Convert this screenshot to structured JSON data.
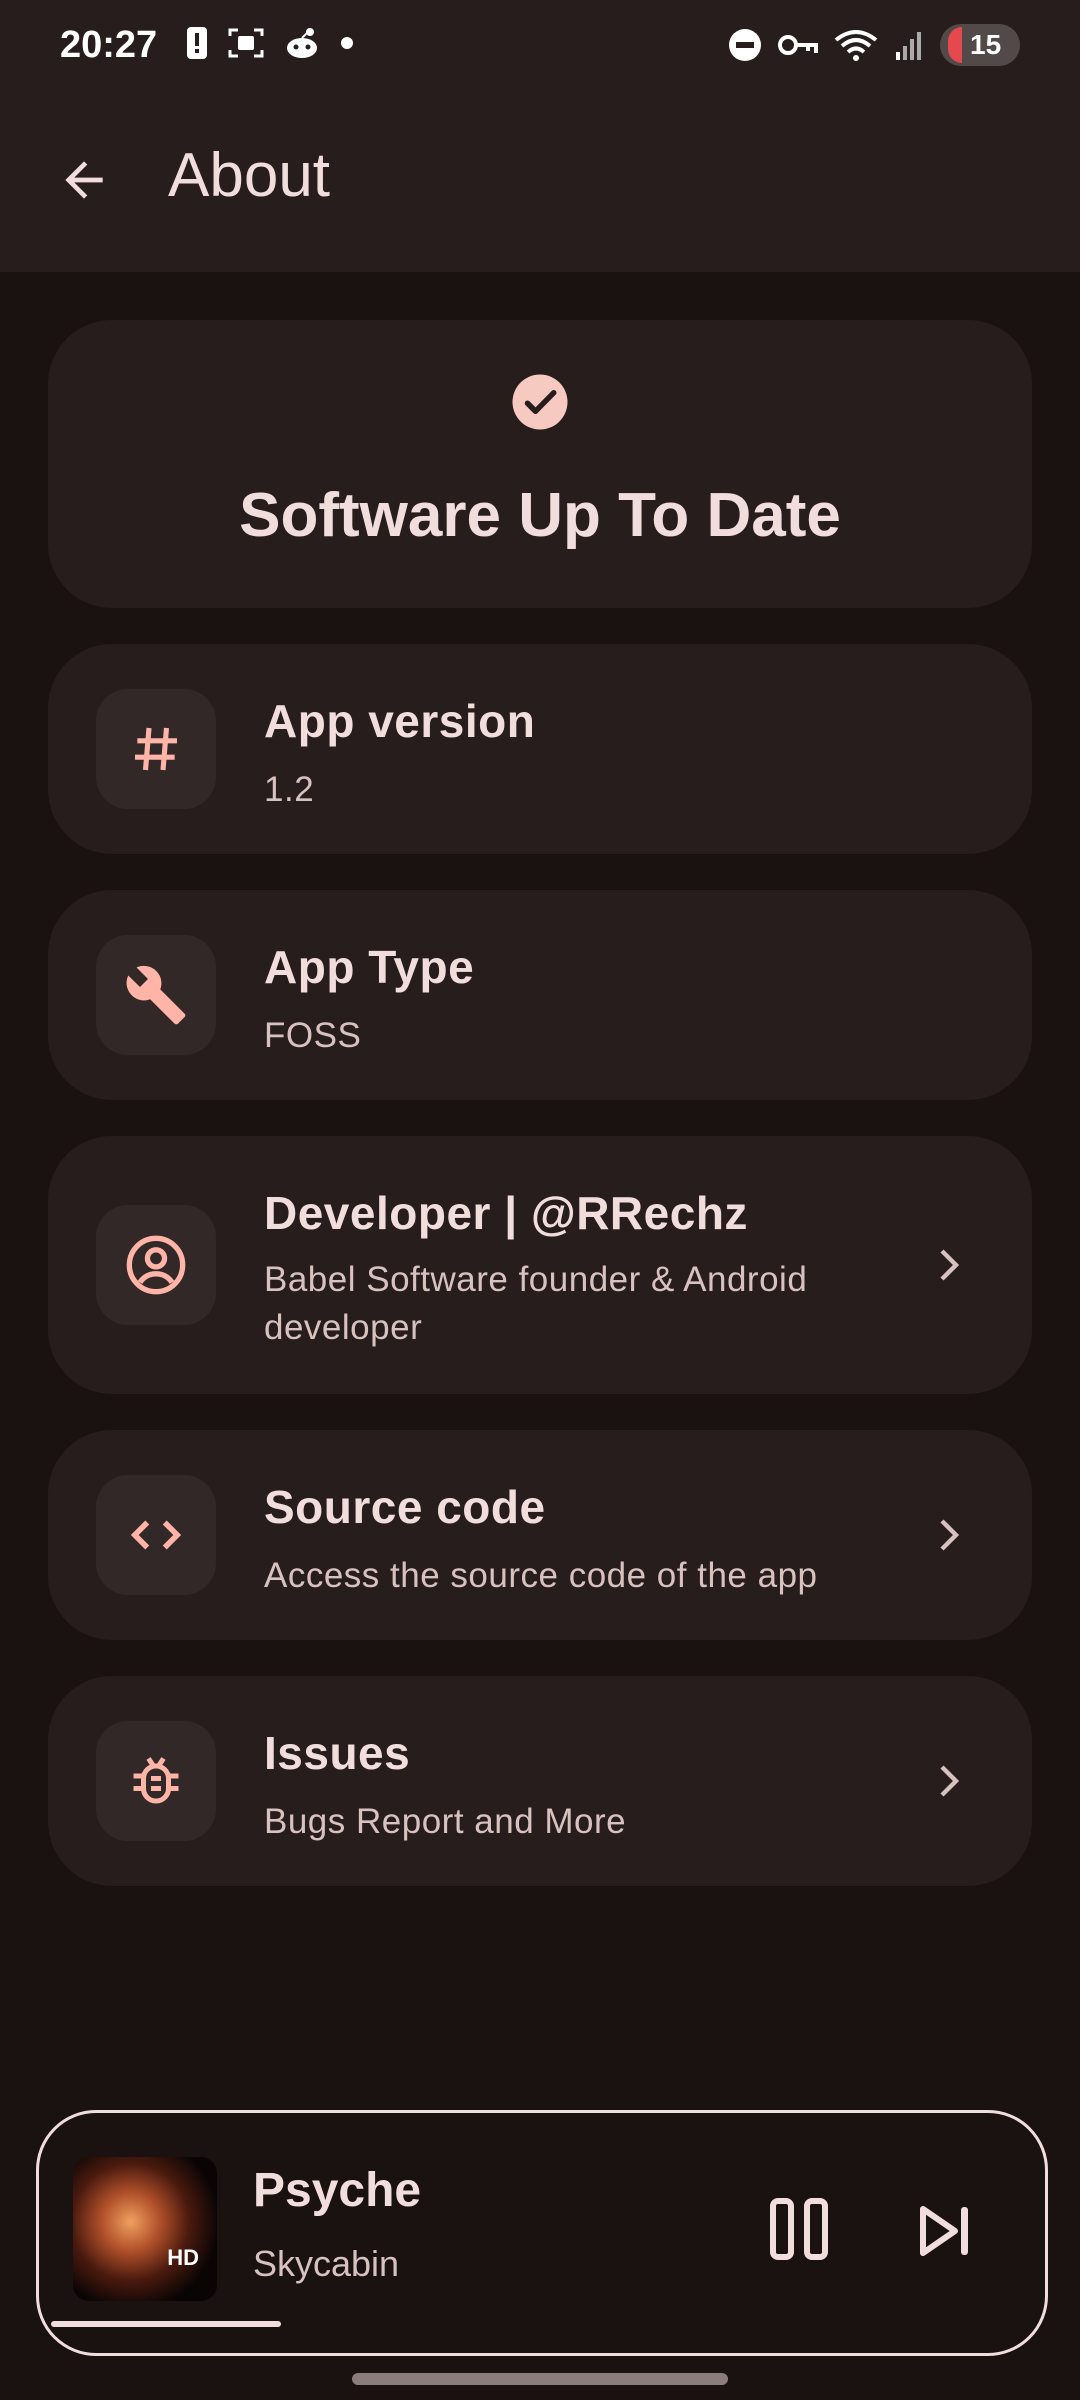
{
  "status_bar": {
    "time": "20:27",
    "battery_level": "15",
    "icons_left": [
      "alert-icon",
      "screenshot-icon",
      "reddit-icon",
      "dot-icon"
    ],
    "icons_right": [
      "dnd-icon",
      "vpn-key-icon",
      "wifi-icon",
      "signal-icon"
    ]
  },
  "top_bar": {
    "title": "About"
  },
  "status_card": {
    "title": "Software Up To Date",
    "icon": "check-circle-icon"
  },
  "rows": [
    {
      "title": "App version",
      "subtitle": "1.2",
      "icon": "hash-icon",
      "chevron": false
    },
    {
      "title": "App Type",
      "subtitle": "FOSS",
      "icon": "wrench-icon",
      "chevron": false
    },
    {
      "title": "Developer | @RRechz",
      "subtitle": "Babel Software founder & Android developer",
      "icon": "account-circle-icon",
      "chevron": true
    },
    {
      "title": "Source code",
      "subtitle": "Access the source code of the app",
      "icon": "code-icon",
      "chevron": true
    },
    {
      "title": "Issues",
      "subtitle": "Bugs Report and More",
      "icon": "bug-icon",
      "chevron": true
    }
  ],
  "player": {
    "song": "Psyche",
    "artist": "Skycabin",
    "album_badge": "HD",
    "progress": 0.23
  },
  "colors": {
    "background": "#1a1111",
    "surface": "#271d1c",
    "accent": "#ffb4a8",
    "text": "#f1dedc"
  }
}
